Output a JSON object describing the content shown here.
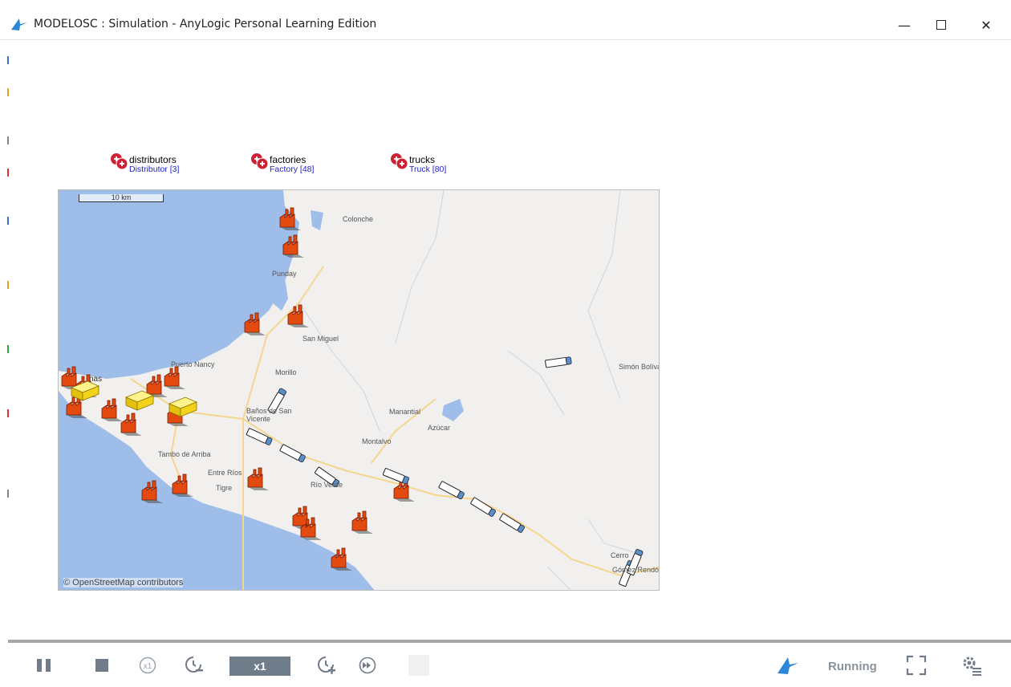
{
  "window": {
    "title": "MODELOSC : Simulation - AnyLogic Personal Learning Edition",
    "controls": {
      "minimize": "—",
      "close": "✕"
    }
  },
  "agents": [
    {
      "name": "distributors",
      "type": "Distributor [3]"
    },
    {
      "name": "factories",
      "type": "Factory [48]"
    },
    {
      "name": "trucks",
      "type": "Truck [80]"
    }
  ],
  "map": {
    "scale_label": "10 km",
    "attribution": "© OpenStreetMap contributors",
    "places": [
      "Colonche",
      "Punday",
      "San Miguel",
      "Morillo",
      "Puerto Nancy",
      "Baños de San Vicente",
      "Manantial",
      "Azúcar",
      "Montalvo",
      "Tambo de Arriba",
      "Entre Ríos",
      "Tigre",
      "Río Verde",
      "Simón Bolívar",
      "Cerro",
      "Gómez Rendón",
      "nas"
    ]
  },
  "controls": {
    "speed": "x1",
    "status": "Running",
    "icons": [
      "pause-icon",
      "stop-icon",
      "run-x1-icon",
      "slow-down-icon",
      "speed-up-icon",
      "fast-forward-icon",
      "anylogic-logo-icon",
      "fullscreen-icon",
      "settings-icon"
    ]
  },
  "colors": {
    "accent": "#2d87d8",
    "speed_bg": "#6f7c8a",
    "factory": "#e24a0f",
    "distributor": "#f3d21a",
    "water": "#9ebde8"
  }
}
